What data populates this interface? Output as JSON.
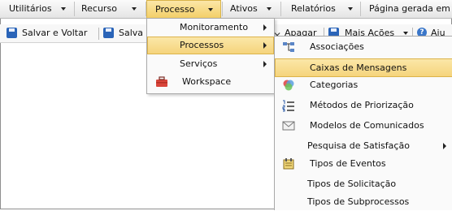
{
  "menubar": {
    "items": [
      {
        "label": "Utilitários"
      },
      {
        "label": "Recurso"
      },
      {
        "label": "Processo"
      },
      {
        "label": "Ativos"
      },
      {
        "label": "Relatórios"
      },
      {
        "label": "Página gerada em"
      }
    ]
  },
  "toolbar": {
    "save_and_back": "Salvar e Voltar",
    "save": "Salva",
    "delete": "Apagar",
    "more_actions": "Mais Ações",
    "help": "Aju"
  },
  "processo_menu": {
    "items": [
      {
        "label": "Monitoramento"
      },
      {
        "label": "Processos"
      },
      {
        "label": "Serviços"
      },
      {
        "label": "Workspace"
      }
    ]
  },
  "processos_submenu": {
    "items": [
      {
        "label": "Associações",
        "icon": "hierarchy-icon"
      },
      {
        "label": "Caixas de Mensagens",
        "icon": "none"
      },
      {
        "label": "Categorias",
        "icon": "color-circles-icon"
      },
      {
        "label": "Métodos de Priorização",
        "icon": "numbered-list-icon"
      },
      {
        "label": "Modelos de Comunicados",
        "icon": "envelope-icon"
      },
      {
        "label": "Pesquisa de Satisfação",
        "icon": "none"
      },
      {
        "label": "Tipos de Eventos",
        "icon": "event-icon"
      },
      {
        "label": "Tipos de Solicitação",
        "icon": "none"
      },
      {
        "label": "Tipos de Subprocessos",
        "icon": "none"
      }
    ]
  },
  "colors": {
    "highlight": "#f5d47c",
    "highlight_border": "#dcb34a"
  }
}
